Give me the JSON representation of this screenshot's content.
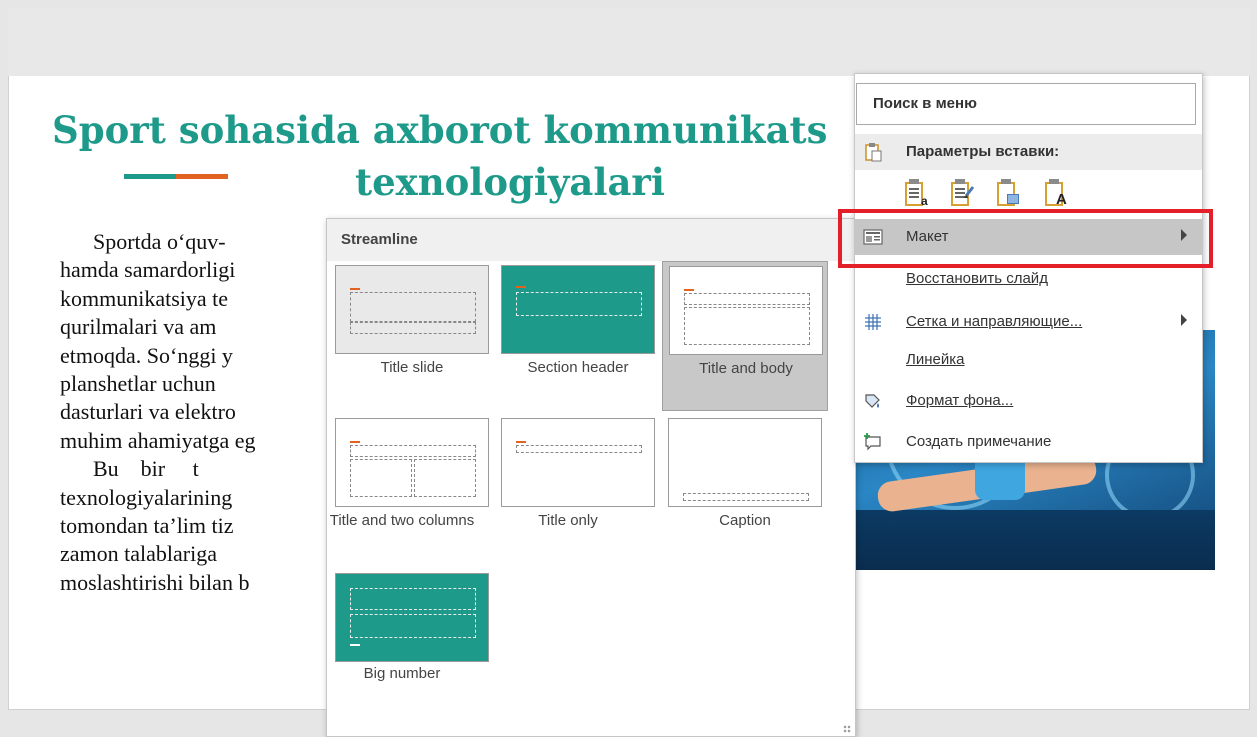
{
  "slide": {
    "title_line1": "Sport sohasida axborot kommunikats",
    "title_line2": "texnologiyalari",
    "body_lines": [
      "      Sportda o‘quv-",
      "hamda samardorligi",
      "kommunikatsiya te",
      "qurilmalari va am",
      "etmoqda. So‘nggi y",
      "planshetlar uchun",
      "dasturlari va elektro",
      "muhim ahamiyatga eg",
      "      Bu    bir     t",
      "texnologiyalarining",
      "tomondan ta’lim tiz",
      "zamon talablariga",
      "moslashtirishi bilan b"
    ],
    "accent_colors": {
      "teal": "#1e9a8b",
      "orange": "#e2621f"
    }
  },
  "gallery": {
    "theme_name": "Streamline",
    "layouts": [
      {
        "label": "Title slide"
      },
      {
        "label": "Section header"
      },
      {
        "label": "Title and body",
        "selected": true
      },
      {
        "label": "Title and two columns"
      },
      {
        "label": "Title only"
      },
      {
        "label": "Caption"
      },
      {
        "label": "Big number"
      }
    ]
  },
  "context_menu": {
    "search_placeholder": "Поиск в меню",
    "paste_options_label": "Параметры вставки:",
    "paste_icons": [
      "paste-keep-source-icon",
      "paste-destination-theme-icon",
      "paste-picture-icon",
      "paste-text-only-icon"
    ],
    "items": [
      {
        "label": "Макет",
        "icon": "layout-icon",
        "has_submenu": true,
        "highlighted": true
      },
      {
        "label": "Восстановить слайд",
        "icon": ""
      },
      {
        "label": "Сетка и направляющие...",
        "icon": "grid-icon",
        "has_submenu": true
      },
      {
        "label": "Линейка",
        "icon": ""
      },
      {
        "label": "Формат фона...",
        "icon": "format-background-icon"
      },
      {
        "label": "Создать примечание",
        "icon": "new-comment-icon"
      }
    ],
    "highlight_color": "#e3202a"
  }
}
